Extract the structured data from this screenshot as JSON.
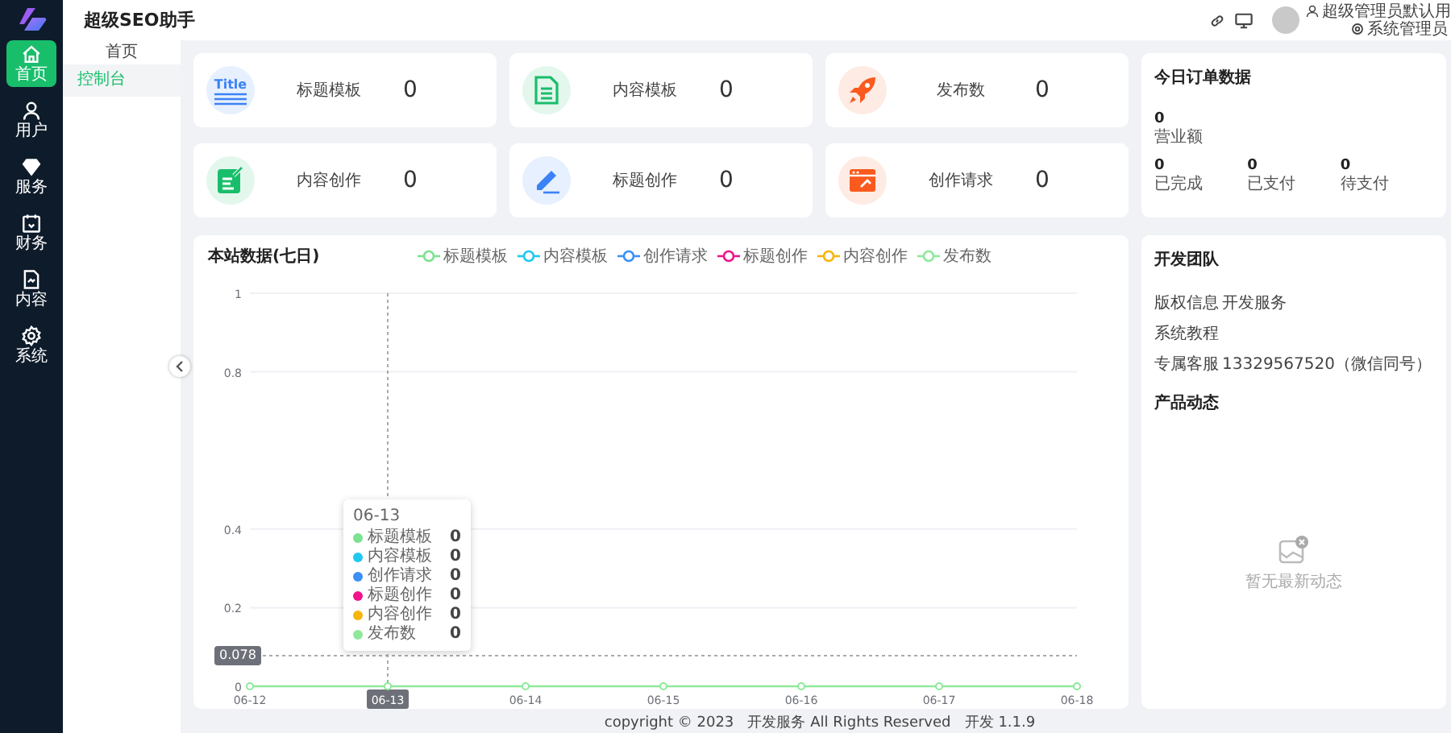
{
  "sidebar": {
    "items": [
      {
        "label": "首页",
        "selected": true
      },
      {
        "label": "用户",
        "selected": false
      },
      {
        "label": "服务",
        "selected": false
      },
      {
        "label": "财务",
        "selected": false
      },
      {
        "label": "内容",
        "selected": false
      },
      {
        "label": "系统",
        "selected": false
      }
    ]
  },
  "header": {
    "title": "超级SEO助手",
    "user_name": "超级管理员默认用",
    "user_role": "系统管理员"
  },
  "subnav": {
    "title": "首页",
    "items": [
      {
        "label": "控制台",
        "selected": true
      }
    ]
  },
  "stats": [
    {
      "label": "标题模板",
      "value": "0",
      "icon_text": "Title",
      "color": "#3b82f6"
    },
    {
      "label": "内容模板",
      "value": "0",
      "color": "#19be6b"
    },
    {
      "label": "发布数",
      "value": "0",
      "color": "#fa5a1e"
    },
    {
      "label": "内容创作",
      "value": "0",
      "color": "#19be6b"
    },
    {
      "label": "标题创作",
      "value": "0",
      "color": "#3b82f6"
    },
    {
      "label": "创作请求",
      "value": "0",
      "color": "#fa5a1e"
    }
  ],
  "orders": {
    "title": "今日订单数据",
    "revenue": {
      "value": "0",
      "label": "营业额"
    },
    "counts": [
      {
        "value": "0",
        "label": "已完成"
      },
      {
        "value": "0",
        "label": "已支付"
      },
      {
        "value": "0",
        "label": "待支付"
      }
    ]
  },
  "chart": {
    "title": "本站数据(七日)",
    "chart_data": {
      "type": "line",
      "grid": true,
      "categories": [
        "06-12",
        "06-13",
        "06-14",
        "06-15",
        "06-16",
        "06-17",
        "06-18"
      ],
      "yticks": [
        0,
        0.2,
        0.4,
        0.8,
        1
      ],
      "ylim": [
        0,
        1
      ],
      "ref_lines": [
        {
          "axis": "x",
          "value": "06-13"
        },
        {
          "axis": "y",
          "value": 0.078,
          "label": "0.078"
        }
      ],
      "series": [
        {
          "name": "标题模板",
          "color": "#7be28f",
          "marker": true,
          "values": [
            null,
            null,
            null,
            null,
            null,
            null,
            null
          ]
        },
        {
          "name": "内容模板",
          "color": "#1ec8f0",
          "marker": true,
          "values": [
            null,
            null,
            null,
            null,
            null,
            null,
            null
          ]
        },
        {
          "name": "创作请求",
          "color": "#3b8ff5",
          "marker": true,
          "values": [
            null,
            null,
            null,
            null,
            null,
            null,
            null
          ]
        },
        {
          "name": "标题创作",
          "color": "#f0138a",
          "marker": true,
          "values": [
            null,
            null,
            null,
            null,
            null,
            null,
            null
          ]
        },
        {
          "name": "内容创作",
          "color": "#f5b50a",
          "marker": true,
          "values": [
            null,
            null,
            null,
            null,
            null,
            null,
            null
          ]
        },
        {
          "name": "发布数",
          "color": "#8fe89a",
          "marker": true,
          "values": [
            0,
            0,
            0,
            0,
            0,
            0,
            0
          ]
        }
      ]
    },
    "tooltip": {
      "title": "06-13",
      "rows": [
        {
          "name": "标题模板",
          "color": "#7be28f",
          "value": "0"
        },
        {
          "name": "内容模板",
          "color": "#1ec8f0",
          "value": "0"
        },
        {
          "name": "创作请求",
          "color": "#3b8ff5",
          "value": "0"
        },
        {
          "name": "标题创作",
          "color": "#f0138a",
          "value": "0"
        },
        {
          "name": "内容创作",
          "color": "#f5b50a",
          "value": "0"
        },
        {
          "name": "发布数",
          "color": "#8fe89a",
          "value": "0"
        }
      ]
    }
  },
  "team": {
    "title": "开发团队",
    "rows": [
      {
        "label": "版权信息",
        "value": "开发服务"
      },
      {
        "label": "系统教程"
      },
      {
        "label": "专属客服",
        "value": "13329567520（微信同号）"
      }
    ]
  },
  "news": {
    "title": "产品动态",
    "empty_text": "暂无最新动态"
  },
  "footer": {
    "text": "copyright © 2023   开发服务 All Rights Reserved   开发 1.1.9"
  }
}
